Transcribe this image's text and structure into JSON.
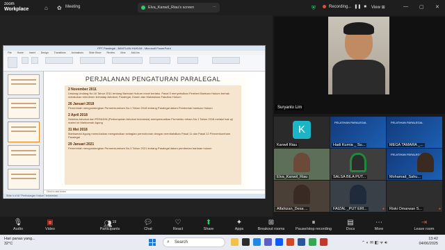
{
  "app": {
    "brand": "zoom",
    "product": "Workplace",
    "meeting_label": "Meeting"
  },
  "share": {
    "label": "Elva_Kanwil_Riau's screen"
  },
  "recording": {
    "label": "Recording..."
  },
  "view": {
    "label": "View"
  },
  "ppt": {
    "window_title": "PPT Paralegal - BANTUAN HUKUM - Microsoft PowerPoint",
    "menu": [
      "File",
      "Home",
      "Insert",
      "Design",
      "Transitions",
      "Animations",
      "Slide Show",
      "Review",
      "View",
      "Add-Ins"
    ],
    "notes_placeholder": "Click to add notes",
    "status": "Slide 4 of 40  \"Perlindungan Hukum\"  Indonesian",
    "slide": {
      "title": "PERJALANAN PENGATURAN PARALEGAL",
      "entries": [
        {
          "date": "2 November 2011",
          "text": "Undang-Undang No.16 Tahun 2011 tentang Bantuan Hukum resmi berlaku. Pasal 9 menyebutkan Pemberi Bantuan Hukum berhak melakukan rekrutmen terhadap Advokat, Paralegal, Dosen dan Mahasiswa Fakultas Hukum"
        },
        {
          "date": "26 Januari 2018",
          "text": "Pemerintah mengundangkan Permenkumham No.1 Tahun 2018 tentang Paralegal dalam Pemberian bantuan Hukum"
        },
        {
          "date": "2 April 2018",
          "text": "Sebelas Advokat dari PERADIN (Perkumpulan Advokat Indonesia) mempersoalkan Permenku mham No.1 Tahun 2018 melalui hak uji materi ke Mahkamah Agung"
        },
        {
          "date": "31 Mei 2018",
          "text": "Mahkamah Agung memutuskan mengabulkan sebagian permohonan dengan membatalkan Pasal 11 dan Pasal 12 Permenkumham Paralegal"
        },
        {
          "date": "29 Januari 2021",
          "text": "Pemerintah mengundangkan Permenkumham No.3 Tahun 2021 tentang Paralegal dalam pemberian bantuan hukum"
        }
      ]
    }
  },
  "speaker": {
    "name": "Suryanto Lim"
  },
  "gallery": [
    {
      "name": "Kanwil Riau",
      "initial": "K",
      "kind": "avatar"
    },
    {
      "name": "Hadi Kurnia _ Su...",
      "kind": "banner",
      "banner_text": "PELATIHAN PARALEGAL"
    },
    {
      "name": "MEGA TAMARA _...",
      "kind": "banner",
      "banner_text": "PELATIHAN PARALEGAL"
    },
    {
      "name": "Elva_Kanwil_Riau",
      "kind": "person",
      "color": "#6b4a3a"
    },
    {
      "name": "SALSA BILA PUT...",
      "kind": "person",
      "color": "#2c2c2c"
    },
    {
      "name": "Mohamad_Sahu...",
      "kind": "banner",
      "banner_text": "PELATIHAN PARALEGAL"
    },
    {
      "name": "Alfahizan_Desa ...",
      "kind": "person",
      "color": "#3a2a24"
    },
    {
      "name": "FAIZAL _PUT ERI...",
      "kind": "person",
      "color": "#1f2a3a"
    },
    {
      "name": "Riski Omarwan S...",
      "kind": "person",
      "color": "#5a4a3a"
    }
  ],
  "toolbar": {
    "audio": "Audio",
    "video": "Video",
    "participants": "Participants",
    "participants_count": "19",
    "chat": "Chat",
    "react": "React",
    "share": "Share",
    "apps": "Apps",
    "breakout": "Breakout rooms",
    "record": "Pause/stop recording",
    "docs": "Docs",
    "more": "More",
    "leave": "Leave room"
  },
  "taskbar": {
    "weather_line1": "Hari panas yang...",
    "weather_line2": "32°C",
    "search_placeholder": "Search",
    "time": "13:42",
    "date": "04/06/2025"
  }
}
